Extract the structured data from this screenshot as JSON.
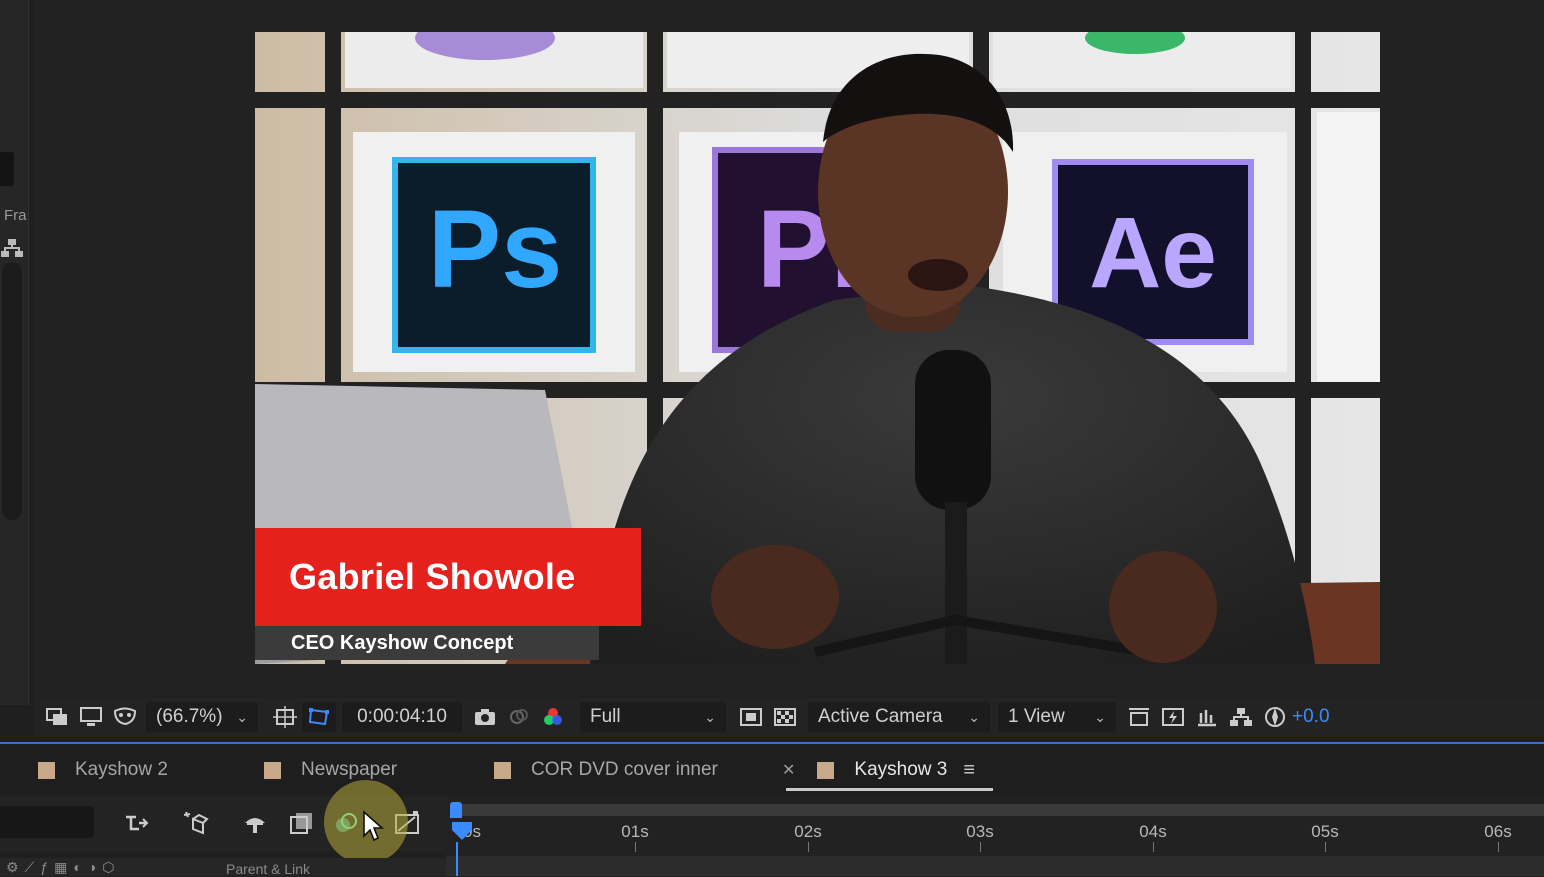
{
  "left_panel": {
    "label": "Fra"
  },
  "viewer": {
    "lower_third": {
      "name": "Gabriel Showole",
      "title": "CEO Kayshow Concept"
    },
    "logos": [
      "Ps",
      "Pr",
      "Ae"
    ]
  },
  "viewer_bar": {
    "magnification": "(66.7%)",
    "timecode": "0:00:04:10",
    "resolution": "Full",
    "camera": "Active Camera",
    "views": "1 View",
    "exposure": "+0.0"
  },
  "timeline_tabs": [
    {
      "label": "Kayshow 2",
      "color": "#c8a98a"
    },
    {
      "label": "Newspaper",
      "color": "#c8a98a"
    },
    {
      "label": "COR DVD cover inner",
      "color": "#c8a98a"
    },
    {
      "label": "Kayshow 3",
      "color": "#c8a98a",
      "active": true
    }
  ],
  "ruler": {
    "labels": [
      "0s",
      "01s",
      "02s",
      "03s",
      "04s",
      "05s",
      "06s"
    ]
  },
  "layer_header": {
    "parent_label": "Parent & Link"
  },
  "colors": {
    "accent": "#3a8bff",
    "lower_third_red": "#e4211c",
    "exposure_blue": "#3e8bf6"
  }
}
